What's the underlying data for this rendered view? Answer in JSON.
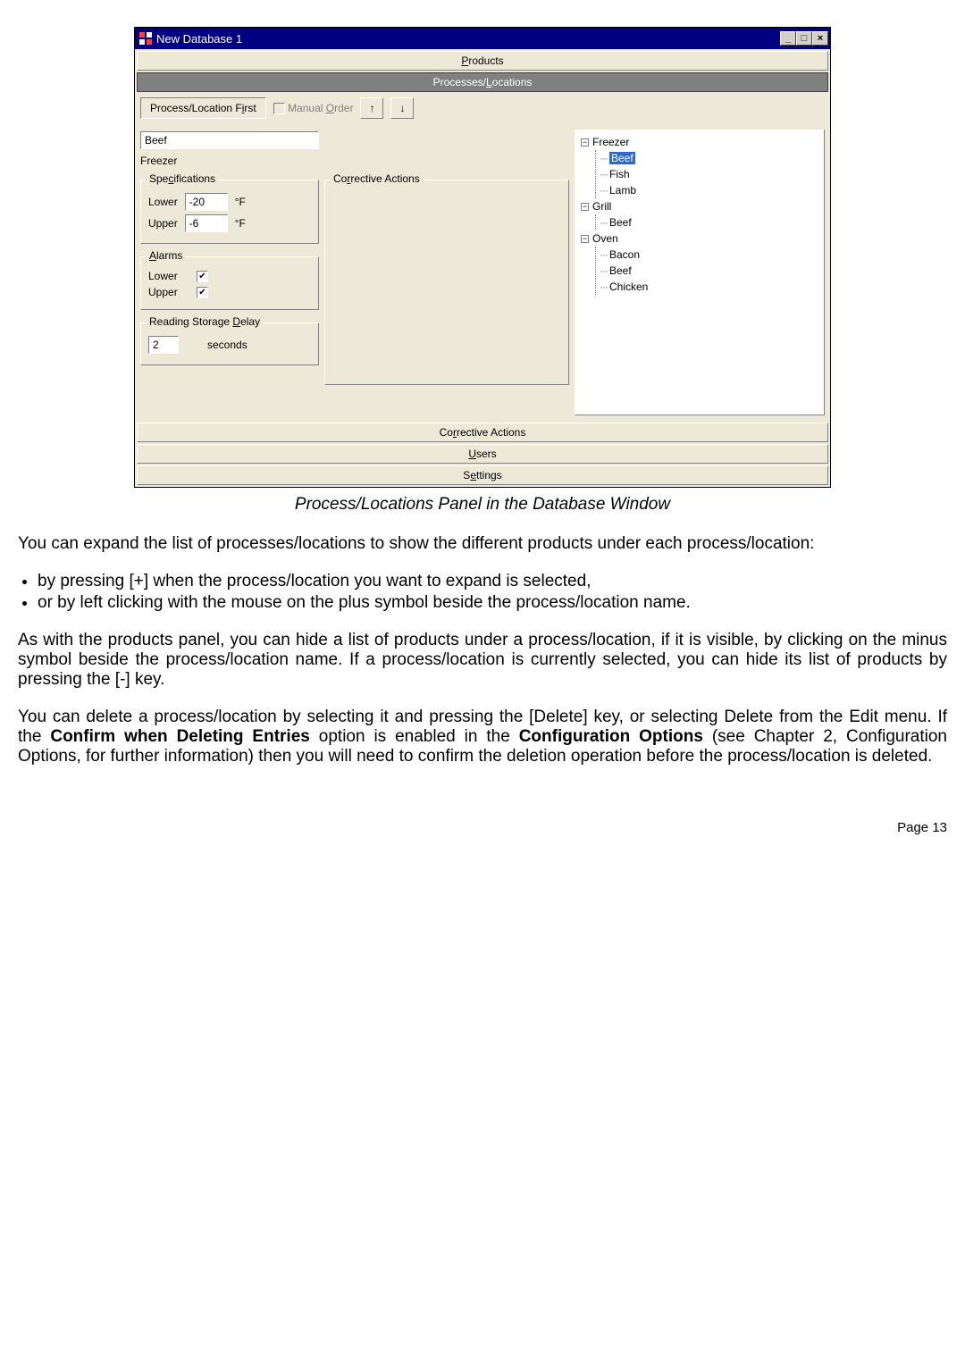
{
  "window": {
    "title": "New Database 1",
    "min_label": "_",
    "max_label": "□",
    "close_label": "×"
  },
  "tabs": {
    "products": "Products",
    "processes_locations": "Processes/Locations",
    "corrective_actions_bottom": "Corrective Actions",
    "users": "Users",
    "settings": "Settings"
  },
  "toolbar": {
    "process_location_first": "Process/Location First",
    "manual_order": "Manual Order"
  },
  "form": {
    "name_value": "Beef",
    "location_value": "Freezer",
    "specifications_legend": "Specifications",
    "lower_label": "Lower",
    "lower_value": "-20",
    "lower_unit": "°F",
    "upper_label": "Upper",
    "upper_value": "-6",
    "upper_unit": "°F",
    "corrective_actions_legend": "Corrective Actions",
    "alarms_legend": "Alarms",
    "alarm_lower_label": "Lower",
    "alarm_upper_label": "Upper",
    "rsd_legend": "Reading Storage Delay",
    "rsd_value": "2",
    "rsd_unit": "seconds"
  },
  "tree": {
    "n0": "Freezer",
    "n0_0": "Beef",
    "n0_1": "Fish",
    "n0_2": "Lamb",
    "n1": "Grill",
    "n1_0": "Beef",
    "n2": "Oven",
    "n2_0": "Bacon",
    "n2_1": "Beef",
    "n2_2": "Chicken"
  },
  "caption": "Process/Locations Panel in the Database Window",
  "doc": {
    "p1": "You can expand the list of processes/locations to show the different products under each process/location:",
    "li1": "by pressing [+] when the process/location you want to expand is selected,",
    "li2": "or by left clicking with the mouse on the plus symbol beside the process/location name.",
    "p2": "As with the products panel, you can hide a list of products under a process/location, if it is visible, by clicking on the minus symbol beside the process/location name. If a process/location is currently selected, you can hide its list of products by pressing the [-] key.",
    "p3a": "You can delete a process/location by selecting it and pressing the [Delete] key, or selecting Delete from the Edit menu.  If the ",
    "p3b": "Confirm when Deleting Entries",
    "p3c": " option is enabled in the ",
    "p3d": "Configuration Options",
    "p3e": " (see Chapter 2, Configuration Options, for further information) then you will need to confirm the deletion operation before the process/location is deleted."
  },
  "page_num": "Page 13"
}
